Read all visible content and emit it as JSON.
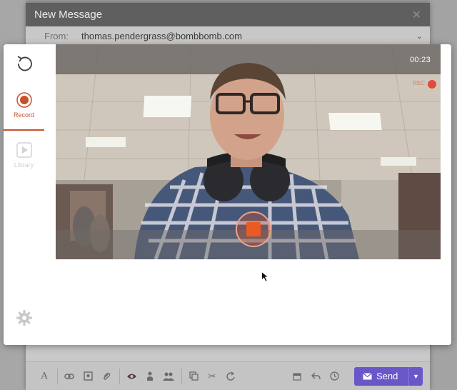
{
  "compose": {
    "title": "New Message",
    "close_glyph": "✕",
    "from_label": "From:",
    "from_value": "thomas.pendergrass@bombbomb.com"
  },
  "modal": {
    "rail": {
      "undo_icon": "undo-icon",
      "record_label": "Record",
      "library_label": "Library",
      "settings_icon": "gear-icon"
    },
    "video": {
      "timer": "00:23",
      "rec_text": "REC"
    }
  },
  "toolbar": {
    "icons": [
      "font-icon",
      "link-icon",
      "image-icon",
      "attachment-icon",
      "eye-icon",
      "person-icon",
      "people-icon",
      "copy-icon",
      "scissors-icon",
      "redo-icon",
      "calendar-icon",
      "reply-icon",
      "clock-icon"
    ],
    "send_label": "Send"
  },
  "colors": {
    "accent_record": "#c9502b",
    "send_button": "#6a57c7",
    "stop_square": "#ea5a22"
  }
}
